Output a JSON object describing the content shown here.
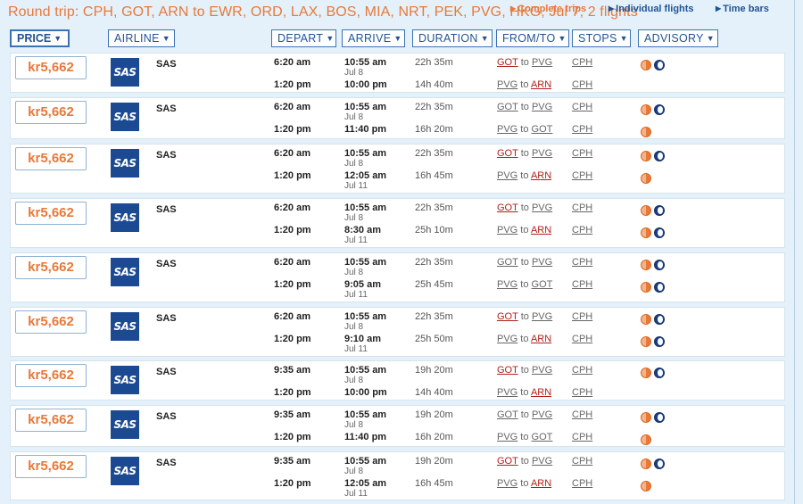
{
  "title": "Round trip: CPH, GOT, ARN to EWR, ORD, LAX, BOS, MIA, NRT, PEK, PVG, HKG, Jul 7, 2 flights",
  "view_links": [
    {
      "label": "Complete trips",
      "name": "complete-trips-link"
    },
    {
      "label": "Individual flights",
      "name": "individual-flights-link"
    },
    {
      "label": "Time bars",
      "name": "time-bars-link"
    }
  ],
  "headers": {
    "price": "PRICE",
    "airline": "AIRLINE",
    "depart": "DEPART",
    "arrive": "ARRIVE",
    "duration": "DURATION",
    "fromto": "FROM/TO",
    "stops": "STOPS",
    "advisory": "ADVISORY"
  },
  "colors": {
    "accent": "#e8793a",
    "link": "#1f5496",
    "airport_red": "#b0201b",
    "sas_blue": "#1b4a92"
  },
  "results": [
    {
      "price": "kr5,662",
      "airline": "SAS",
      "logo": "SAS",
      "legs": [
        {
          "depart": "6:20 am",
          "arrive": "10:55 am",
          "arrive_date": "Jul 8",
          "duration": "22h 35m",
          "from": "GOT",
          "to": "PVG",
          "from_red": true,
          "to_red": false,
          "to_word": "to",
          "stop": "CPH",
          "advisory": [
            "sun",
            "moon"
          ]
        },
        {
          "depart": "1:20 pm",
          "arrive": "10:00 pm",
          "arrive_date": "",
          "duration": "14h 40m",
          "from": "PVG",
          "to": "ARN",
          "from_red": false,
          "to_red": true,
          "to_word": "to",
          "stop": "CPH",
          "advisory": []
        }
      ]
    },
    {
      "price": "kr5,662",
      "airline": "SAS",
      "logo": "SAS",
      "legs": [
        {
          "depart": "6:20 am",
          "arrive": "10:55 am",
          "arrive_date": "Jul 8",
          "duration": "22h 35m",
          "from": "GOT",
          "to": "PVG",
          "from_red": false,
          "to_red": false,
          "to_word": "to",
          "stop": "CPH",
          "advisory": [
            "sun",
            "moon"
          ]
        },
        {
          "depart": "1:20 pm",
          "arrive": "11:40 pm",
          "arrive_date": "",
          "duration": "16h 20m",
          "from": "PVG",
          "to": "GOT",
          "from_red": false,
          "to_red": false,
          "to_word": "to",
          "stop": "CPH",
          "advisory": [
            "sun"
          ]
        }
      ]
    },
    {
      "price": "kr5,662",
      "airline": "SAS",
      "logo": "SAS",
      "legs": [
        {
          "depart": "6:20 am",
          "arrive": "10:55 am",
          "arrive_date": "Jul 8",
          "duration": "22h 35m",
          "from": "GOT",
          "to": "PVG",
          "from_red": true,
          "to_red": false,
          "to_word": "to",
          "stop": "CPH",
          "advisory": [
            "sun",
            "moon"
          ]
        },
        {
          "depart": "1:20 pm",
          "arrive": "12:05 am",
          "arrive_date": "Jul 11",
          "duration": "16h 45m",
          "from": "PVG",
          "to": "ARN",
          "from_red": false,
          "to_red": true,
          "to_word": "to",
          "stop": "CPH",
          "advisory": [
            "sun"
          ]
        }
      ]
    },
    {
      "price": "kr5,662",
      "airline": "SAS",
      "logo": "SAS",
      "legs": [
        {
          "depart": "6:20 am",
          "arrive": "10:55 am",
          "arrive_date": "Jul 8",
          "duration": "22h 35m",
          "from": "GOT",
          "to": "PVG",
          "from_red": true,
          "to_red": false,
          "to_word": "to",
          "stop": "CPH",
          "advisory": [
            "sun",
            "moon"
          ]
        },
        {
          "depart": "1:20 pm",
          "arrive": "8:30 am",
          "arrive_date": "Jul 11",
          "duration": "25h 10m",
          "from": "PVG",
          "to": "ARN",
          "from_red": false,
          "to_red": true,
          "to_word": "to",
          "stop": "CPH",
          "advisory": [
            "sun",
            "moon"
          ]
        }
      ]
    },
    {
      "price": "kr5,662",
      "airline": "SAS",
      "logo": "SAS",
      "legs": [
        {
          "depart": "6:20 am",
          "arrive": "10:55 am",
          "arrive_date": "Jul 8",
          "duration": "22h 35m",
          "from": "GOT",
          "to": "PVG",
          "from_red": false,
          "to_red": false,
          "to_word": "to",
          "stop": "CPH",
          "advisory": [
            "sun",
            "moon"
          ]
        },
        {
          "depart": "1:20 pm",
          "arrive": "9:05 am",
          "arrive_date": "Jul 11",
          "duration": "25h 45m",
          "from": "PVG",
          "to": "GOT",
          "from_red": false,
          "to_red": false,
          "to_word": "to",
          "stop": "CPH",
          "advisory": [
            "sun",
            "moon"
          ]
        }
      ]
    },
    {
      "price": "kr5,662",
      "airline": "SAS",
      "logo": "SAS",
      "legs": [
        {
          "depart": "6:20 am",
          "arrive": "10:55 am",
          "arrive_date": "Jul 8",
          "duration": "22h 35m",
          "from": "GOT",
          "to": "PVG",
          "from_red": true,
          "to_red": false,
          "to_word": "to",
          "stop": "CPH",
          "advisory": [
            "sun",
            "moon"
          ]
        },
        {
          "depart": "1:20 pm",
          "arrive": "9:10 am",
          "arrive_date": "Jul 11",
          "duration": "25h 50m",
          "from": "PVG",
          "to": "ARN",
          "from_red": false,
          "to_red": true,
          "to_word": "to",
          "stop": "CPH",
          "advisory": [
            "sun",
            "moon"
          ]
        }
      ]
    },
    {
      "price": "kr5,662",
      "airline": "SAS",
      "logo": "SAS",
      "legs": [
        {
          "depart": "9:35 am",
          "arrive": "10:55 am",
          "arrive_date": "Jul 8",
          "duration": "19h 20m",
          "from": "GOT",
          "to": "PVG",
          "from_red": true,
          "to_red": false,
          "to_word": "to",
          "stop": "CPH",
          "advisory": [
            "sun",
            "moon"
          ]
        },
        {
          "depart": "1:20 pm",
          "arrive": "10:00 pm",
          "arrive_date": "",
          "duration": "14h 40m",
          "from": "PVG",
          "to": "ARN",
          "from_red": false,
          "to_red": true,
          "to_word": "to",
          "stop": "CPH",
          "advisory": []
        }
      ]
    },
    {
      "price": "kr5,662",
      "airline": "SAS",
      "logo": "SAS",
      "legs": [
        {
          "depart": "9:35 am",
          "arrive": "10:55 am",
          "arrive_date": "Jul 8",
          "duration": "19h 20m",
          "from": "GOT",
          "to": "PVG",
          "from_red": false,
          "to_red": false,
          "to_word": "to",
          "stop": "CPH",
          "advisory": [
            "sun",
            "moon"
          ]
        },
        {
          "depart": "1:20 pm",
          "arrive": "11:40 pm",
          "arrive_date": "",
          "duration": "16h 20m",
          "from": "PVG",
          "to": "GOT",
          "from_red": false,
          "to_red": false,
          "to_word": "to",
          "stop": "CPH",
          "advisory": [
            "sun"
          ]
        }
      ]
    },
    {
      "price": "kr5,662",
      "airline": "SAS",
      "logo": "SAS",
      "legs": [
        {
          "depart": "9:35 am",
          "arrive": "10:55 am",
          "arrive_date": "Jul 8",
          "duration": "19h 20m",
          "from": "GOT",
          "to": "PVG",
          "from_red": true,
          "to_red": false,
          "to_word": "to",
          "stop": "CPH",
          "advisory": [
            "sun",
            "moon"
          ]
        },
        {
          "depart": "1:20 pm",
          "arrive": "12:05 am",
          "arrive_date": "Jul 11",
          "duration": "16h 45m",
          "from": "PVG",
          "to": "ARN",
          "from_red": false,
          "to_red": true,
          "to_word": "to",
          "stop": "CPH",
          "advisory": [
            "sun"
          ]
        }
      ]
    }
  ]
}
